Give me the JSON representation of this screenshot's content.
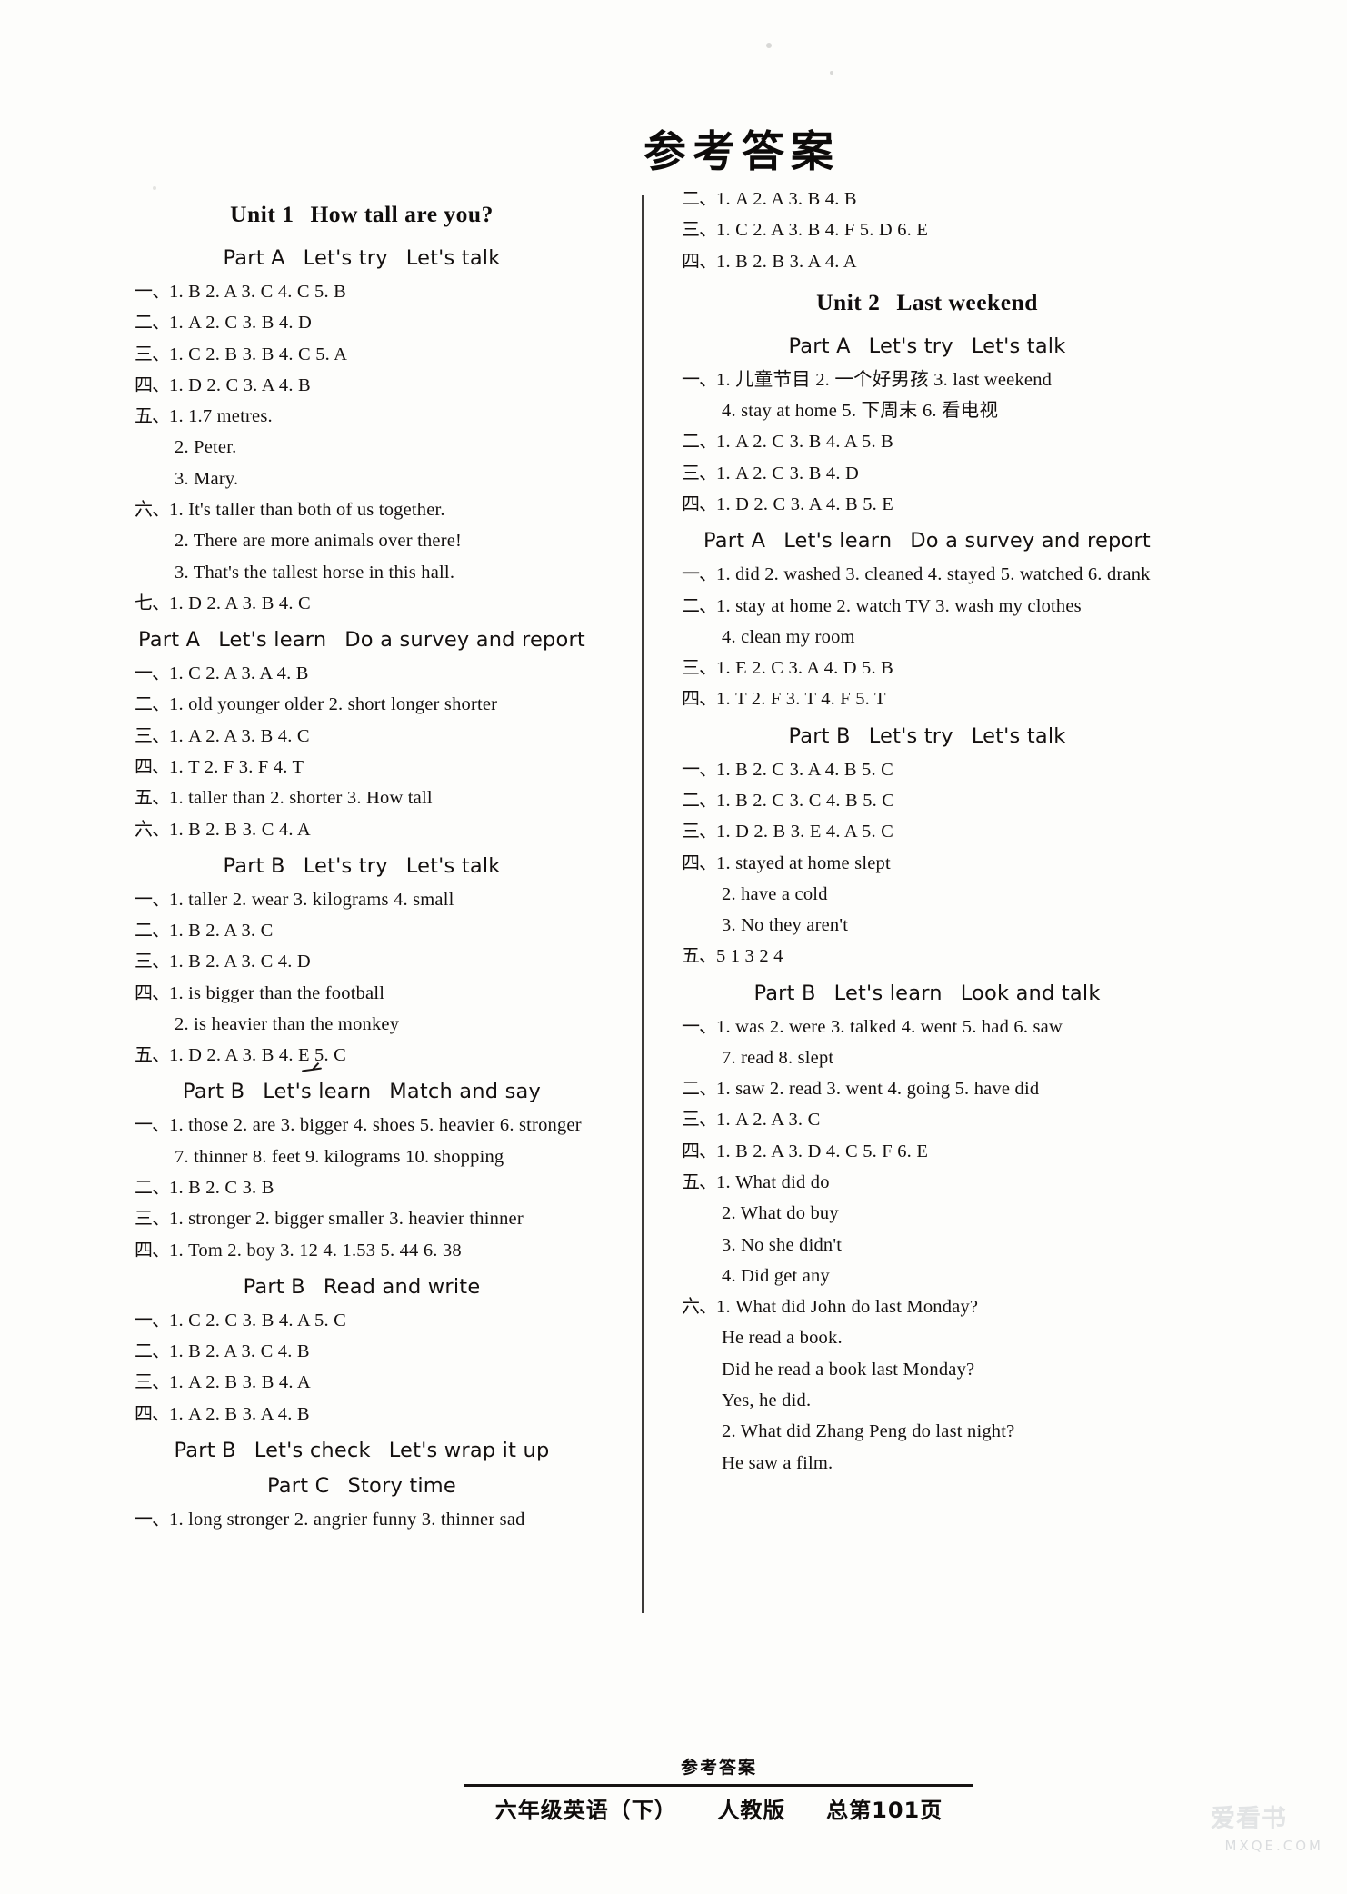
{
  "masthead": {
    "title": "参考答案"
  },
  "left_column": {
    "blocks": [
      {
        "type": "unit",
        "number": "Unit 1",
        "name": "How tall are you?"
      },
      {
        "type": "part",
        "segments": [
          "Part A",
          "Let's try",
          "Let's talk"
        ]
      },
      {
        "type": "answer",
        "marker": "一、",
        "text": "1. B   2. A   3. C   4. C   5. B"
      },
      {
        "type": "answer",
        "marker": "二、",
        "text": "1. A   2. C   3. B   4. D"
      },
      {
        "type": "answer",
        "marker": "三、",
        "text": "1. C   2. B   3. B   4. C   5. A"
      },
      {
        "type": "answer",
        "marker": "四、",
        "text": "1. D   2. C   3. A   4. B"
      },
      {
        "type": "answer",
        "marker": "五、",
        "text": "1. 1.7 metres."
      },
      {
        "type": "answer-cont",
        "marker": "",
        "text": "2. Peter."
      },
      {
        "type": "answer-cont",
        "marker": "",
        "text": "3. Mary."
      },
      {
        "type": "answer",
        "marker": "六、",
        "text": "1. It's taller than both of us together."
      },
      {
        "type": "answer-cont",
        "marker": "",
        "text": "2. There are more animals over there!"
      },
      {
        "type": "answer-cont",
        "marker": "",
        "text": "3. That's the tallest horse in this hall."
      },
      {
        "type": "answer",
        "marker": "七、",
        "text": "1. D   2. A   3. B   4. C"
      },
      {
        "type": "part",
        "segments": [
          "Part A",
          "Let's learn",
          "Do a survey and report"
        ]
      },
      {
        "type": "answer",
        "marker": "一、",
        "text": "1. C   2. A   3. A   4. B"
      },
      {
        "type": "answer",
        "marker": "二、",
        "text": "1. old   younger   older   2. short   longer   shorter"
      },
      {
        "type": "answer",
        "marker": "三、",
        "text": "1. A   2. A   3. B   4. C"
      },
      {
        "type": "answer",
        "marker": "四、",
        "text": "1. T   2. F   3. F   4. T"
      },
      {
        "type": "answer",
        "marker": "五、",
        "text": "1. taller   than   2. shorter   3. How   tall"
      },
      {
        "type": "answer",
        "marker": "六、",
        "text": "1. B   2. B   3. C   4. A"
      },
      {
        "type": "part",
        "segments": [
          "Part B",
          "Let's try",
          "Let's talk"
        ]
      },
      {
        "type": "answer",
        "marker": "一、",
        "text": "1. taller   2. wear   3. kilograms   4. small"
      },
      {
        "type": "answer",
        "marker": "二、",
        "text": "1. B   2. A   3. C"
      },
      {
        "type": "answer",
        "marker": "三、",
        "text": "1. B   2. A   3. C   4. D"
      },
      {
        "type": "answer",
        "marker": "四、",
        "text": "1. is bigger than the football"
      },
      {
        "type": "answer-cont",
        "marker": "",
        "text": "2. is heavier than the monkey"
      },
      {
        "type": "answer",
        "marker": "五、",
        "text": "1. D   2. A   3. B   4. E   5. C"
      },
      {
        "type": "part",
        "segments": [
          "Part B",
          "Let's learn",
          "Match and say"
        ]
      },
      {
        "type": "answer",
        "marker": "一、",
        "text": "1. those   2. are   3. bigger   4. shoes   5. heavier   6. stronger"
      },
      {
        "type": "answer-cont",
        "marker": "",
        "text": "7. thinner   8. feet   9. kilograms   10. shopping"
      },
      {
        "type": "answer",
        "marker": "二、",
        "text": "1. B   2. C   3. B"
      },
      {
        "type": "answer",
        "marker": "三、",
        "text": "1. stronger   2. bigger   smaller   3. heavier   thinner"
      },
      {
        "type": "answer",
        "marker": "四、",
        "text": "1. Tom   2. boy   3. 12   4. 1.53   5. 44   6. 38"
      },
      {
        "type": "part",
        "segments": [
          "Part B",
          "Read and write"
        ]
      },
      {
        "type": "answer",
        "marker": "一、",
        "text": "1. C   2. C   3. B   4. A   5. C"
      },
      {
        "type": "answer",
        "marker": "二、",
        "text": "1. B   2. A   3. C   4. B"
      },
      {
        "type": "answer",
        "marker": "三、",
        "text": "1. A   2. B   3. B   4. A"
      },
      {
        "type": "answer",
        "marker": "四、",
        "text": "1. A   2. B   3. A   4. B"
      },
      {
        "type": "part",
        "segments": [
          "Part B",
          "Let's check",
          "Let's wrap it up"
        ]
      },
      {
        "type": "part",
        "segments": [
          "Part C",
          "Story time"
        ]
      },
      {
        "type": "answer",
        "marker": "一、",
        "text": "1. long   stronger   2. angrier   funny   3. thinner   sad"
      }
    ]
  },
  "right_column": {
    "blocks": [
      {
        "type": "answer",
        "marker": "二、",
        "text": "1. A   2. A   3. B   4. B"
      },
      {
        "type": "answer",
        "marker": "三、",
        "text": "1. C   2. A   3. B   4. F   5. D   6. E"
      },
      {
        "type": "answer",
        "marker": "四、",
        "text": "1. B   2. B   3. A   4. A"
      },
      {
        "type": "unit",
        "number": "Unit 2",
        "name": "Last weekend"
      },
      {
        "type": "part",
        "segments": [
          "Part A",
          "Let's try",
          "Let's talk"
        ]
      },
      {
        "type": "answer",
        "marker": "一、",
        "text": "1. 儿童节目   2. 一个好男孩   3. last weekend"
      },
      {
        "type": "answer-cont",
        "marker": "",
        "text": "4. stay at home   5. 下周末   6. 看电视"
      },
      {
        "type": "answer",
        "marker": "二、",
        "text": "1. A   2. C   3. B   4. A   5. B"
      },
      {
        "type": "answer",
        "marker": "三、",
        "text": "1. A   2. C   3. B   4. D"
      },
      {
        "type": "answer",
        "marker": "四、",
        "text": "1. D   2. C   3. A   4. B   5. E"
      },
      {
        "type": "part",
        "segments": [
          "Part A",
          "Let's learn",
          "Do a survey and report"
        ]
      },
      {
        "type": "answer",
        "marker": "一、",
        "text": "1. did   2. washed   3. cleaned   4. stayed   5. watched   6. drank"
      },
      {
        "type": "answer",
        "marker": "二、",
        "text": "1. stay at home   2. watch TV   3. wash my clothes"
      },
      {
        "type": "answer-cont",
        "marker": "",
        "text": "4. clean my room"
      },
      {
        "type": "answer",
        "marker": "三、",
        "text": "1. E   2. C   3. A   4. D   5. B"
      },
      {
        "type": "answer",
        "marker": "四、",
        "text": "1. T   2. F   3. T   4. F   5. T"
      },
      {
        "type": "part",
        "segments": [
          "Part B",
          "Let's try",
          "Let's talk"
        ]
      },
      {
        "type": "answer",
        "marker": "一、",
        "text": "1. B   2. C   3. A   4. B   5. C"
      },
      {
        "type": "answer",
        "marker": "二、",
        "text": "1. B   2. C   3. C   4. B   5. C"
      },
      {
        "type": "answer",
        "marker": "三、",
        "text": "1. D   2. B   3. E   4. A   5. C"
      },
      {
        "type": "answer",
        "marker": "四、",
        "text": "1. stayed   at   home   slept"
      },
      {
        "type": "answer-cont",
        "marker": "",
        "text": "2. have   a   cold"
      },
      {
        "type": "answer-cont",
        "marker": "",
        "text": "3. No   they   aren't"
      },
      {
        "type": "answer",
        "marker": "五、",
        "text": "5   1   3   2   4"
      },
      {
        "type": "part",
        "segments": [
          "Part B",
          "Let's learn",
          "Look and talk"
        ]
      },
      {
        "type": "answer",
        "marker": "一、",
        "text": "1. was   2. were   3. talked   4. went   5. had   6. saw"
      },
      {
        "type": "answer-cont",
        "marker": "",
        "text": "7. read   8. slept"
      },
      {
        "type": "answer",
        "marker": "二、",
        "text": "1. saw   2. read   3. went   4. going   5. have   did"
      },
      {
        "type": "answer",
        "marker": "三、",
        "text": "1. A   2. A   3. C"
      },
      {
        "type": "answer",
        "marker": "四、",
        "text": "1. B   2. A   3. D   4. C   5. F   6. E"
      },
      {
        "type": "answer",
        "marker": "五、",
        "text": "1. What   did   do"
      },
      {
        "type": "answer-cont",
        "marker": "",
        "text": "2. What   do   buy"
      },
      {
        "type": "answer-cont",
        "marker": "",
        "text": "3. No   she   didn't"
      },
      {
        "type": "answer-cont",
        "marker": "",
        "text": "4. Did   get   any"
      },
      {
        "type": "answer",
        "marker": "六、",
        "text": "1. What did John do last Monday?"
      },
      {
        "type": "answer-cont",
        "marker": "",
        "text": "He read a book."
      },
      {
        "type": "answer-cont",
        "marker": "",
        "text": "Did he read a book last Monday?"
      },
      {
        "type": "answer-cont",
        "marker": "",
        "text": "Yes, he did."
      },
      {
        "type": "answer-cont",
        "marker": "",
        "text": "2. What did Zhang Peng do last night?"
      },
      {
        "type": "answer-cont",
        "marker": "",
        "text": "He saw a film."
      }
    ]
  },
  "footer": {
    "top_label": "参考答案",
    "grade": "六年级英语（下）",
    "edition": "人教版",
    "page": "总第101页"
  },
  "watermark": {
    "cn": "爱看书",
    "en": "MXQE.COM"
  }
}
